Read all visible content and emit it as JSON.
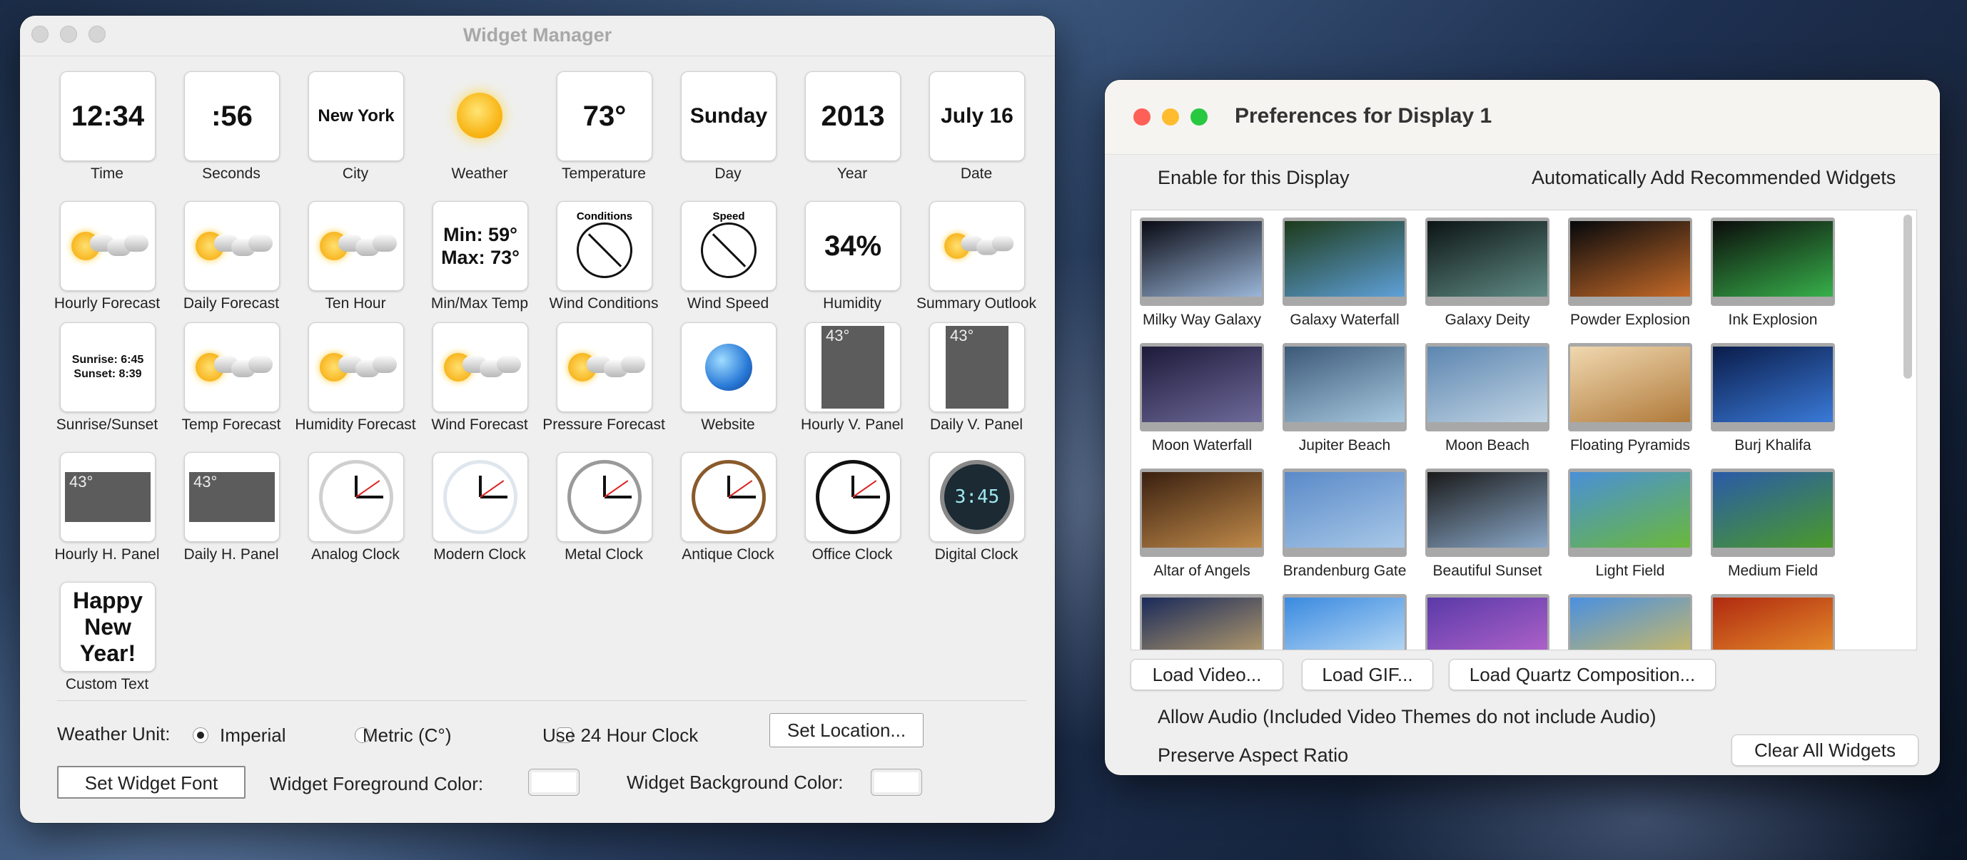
{
  "widget_manager": {
    "title": "Widget Manager",
    "tiles": [
      {
        "label": "Time",
        "text": "12:34",
        "kind": "text"
      },
      {
        "label": "Seconds",
        "text": ":56",
        "kind": "text"
      },
      {
        "label": "City",
        "text": "New York",
        "kind": "small"
      },
      {
        "label": "Weather",
        "kind": "sun"
      },
      {
        "label": "Temperature",
        "text": "73°",
        "kind": "text"
      },
      {
        "label": "Day",
        "text": "Sunday",
        "kind": "text"
      },
      {
        "label": "Year",
        "text": "2013",
        "kind": "text"
      },
      {
        "label": "Date",
        "text": "July 16",
        "kind": "text"
      },
      {
        "label": "Hourly Forecast",
        "kind": "forecast"
      },
      {
        "label": "Daily Forecast",
        "kind": "forecast"
      },
      {
        "label": "Ten Hour",
        "kind": "forecast"
      },
      {
        "label": "Min/Max Temp",
        "text": "Min: 59°\nMax: 73°",
        "kind": "minmax"
      },
      {
        "label": "Wind Conditions",
        "text": "Conditions",
        "kind": "gauge"
      },
      {
        "label": "Wind Speed",
        "text": "Speed",
        "kind": "gauge"
      },
      {
        "label": "Humidity",
        "text": "34%",
        "kind": "text"
      },
      {
        "label": "Summary Outlook",
        "kind": "outlook"
      },
      {
        "label": "Sunrise/Sunset",
        "text": "Sunrise: 6:45\nSunset: 8:39",
        "kind": "sunrise"
      },
      {
        "label": "Temp Forecast",
        "kind": "forecast"
      },
      {
        "label": "Humidity Forecast",
        "kind": "forecast"
      },
      {
        "label": "Wind Forecast",
        "kind": "forecast"
      },
      {
        "label": "Pressure Forecast",
        "kind": "forecast"
      },
      {
        "label": "Website",
        "kind": "globe"
      },
      {
        "label": "Hourly V. Panel",
        "text": "43°",
        "kind": "vpanel"
      },
      {
        "label": "Daily V. Panel",
        "text": "43°",
        "kind": "vpanel"
      },
      {
        "label": "Hourly H. Panel",
        "text": "43°",
        "kind": "hpanel"
      },
      {
        "label": "Daily H. Panel",
        "text": "43°",
        "kind": "hpanel"
      },
      {
        "label": "Analog Clock",
        "kind": "clock",
        "ring": "#cfcfcf"
      },
      {
        "label": "Modern Clock",
        "kind": "clock",
        "ring": "#dfe6ee"
      },
      {
        "label": "Metal Clock",
        "kind": "clock",
        "ring": "#9a9a9a"
      },
      {
        "label": "Antique Clock",
        "kind": "clock",
        "ring": "#8a5a2c"
      },
      {
        "label": "Office Clock",
        "kind": "clock",
        "ring": "#111111"
      },
      {
        "label": "Digital Clock",
        "text": "3:45",
        "kind": "digital"
      },
      {
        "label": "Custom Text",
        "text": "Happy\nNew\nYear!",
        "kind": "custom"
      }
    ],
    "weather_unit_label": "Weather Unit:",
    "imperial_label": "Imperial",
    "metric_label": "Metric (C°)",
    "use24_label": "Use 24 Hour Clock",
    "set_location_label": "Set Location...",
    "set_font_label": "Set Widget Font",
    "fg_color_label": "Widget Foreground Color:",
    "bg_color_label": "Widget Background Color:",
    "imperial_selected": true,
    "use24_checked": false
  },
  "preferences": {
    "title": "Preferences for Display 1",
    "enable_label": "Enable for this Display",
    "enable_checked": true,
    "auto_add_label": "Automatically Add Recommended Widgets",
    "auto_add_checked": false,
    "themes": [
      {
        "label": "Milky Way Galaxy",
        "colors": [
          "#0a0a14",
          "#9ab6d8"
        ]
      },
      {
        "label": "Galaxy Waterfall",
        "colors": [
          "#1d3a1a",
          "#5fa0d8"
        ]
      },
      {
        "label": "Galaxy Deity",
        "colors": [
          "#0c1414",
          "#5f8a84"
        ]
      },
      {
        "label": "Powder Explosion",
        "colors": [
          "#05080c",
          "#c56a28"
        ]
      },
      {
        "label": "Ink Explosion",
        "colors": [
          "#0b0b0b",
          "#37b04a"
        ]
      },
      {
        "label": "Moon Waterfall",
        "colors": [
          "#1e1a3a",
          "#6d6a9a"
        ]
      },
      {
        "label": "Jupiter Beach",
        "colors": [
          "#3c5a78",
          "#a8c8e0"
        ]
      },
      {
        "label": "Moon Beach",
        "colors": [
          "#5d86b0",
          "#c0d4e4"
        ]
      },
      {
        "label": "Floating Pyramids",
        "colors": [
          "#f0d8b0",
          "#b07a3a"
        ]
      },
      {
        "label": "Burj Khalifa",
        "colors": [
          "#0a1c4a",
          "#3a7ad8"
        ]
      },
      {
        "label": "Altar of Angels",
        "colors": [
          "#3a2010",
          "#c08a4a"
        ]
      },
      {
        "label": "Brandenburg Gate",
        "colors": [
          "#5a8ac8",
          "#a8c8e8"
        ]
      },
      {
        "label": "Beautiful Sunset",
        "colors": [
          "#1a1a1a",
          "#8aa8c8"
        ]
      },
      {
        "label": "Light Field",
        "colors": [
          "#4a90d8",
          "#6ab83a"
        ]
      },
      {
        "label": "Medium Field",
        "colors": [
          "#2a5aa8",
          "#4a9a2a"
        ]
      },
      {
        "label": "",
        "colors": [
          "#1a2a5a",
          "#d0b070"
        ]
      },
      {
        "label": "",
        "colors": [
          "#3a8ae0",
          "#d0e8f8"
        ]
      },
      {
        "label": "",
        "colors": [
          "#5a3aa8",
          "#c06ad0"
        ]
      },
      {
        "label": "",
        "colors": [
          "#4a90e0",
          "#e0c050"
        ]
      },
      {
        "label": "",
        "colors": [
          "#b02a10",
          "#f0a030"
        ]
      }
    ],
    "load_video_label": "Load Video...",
    "load_gif_label": "Load GIF...",
    "load_qc_label": "Load Quartz Composition...",
    "allow_audio_label": "Allow Audio (Included Video Themes do not include Audio)",
    "allow_audio_checked": true,
    "preserve_label": "Preserve Aspect Ratio",
    "preserve_checked": false,
    "clear_all_label": "Clear All Widgets"
  }
}
